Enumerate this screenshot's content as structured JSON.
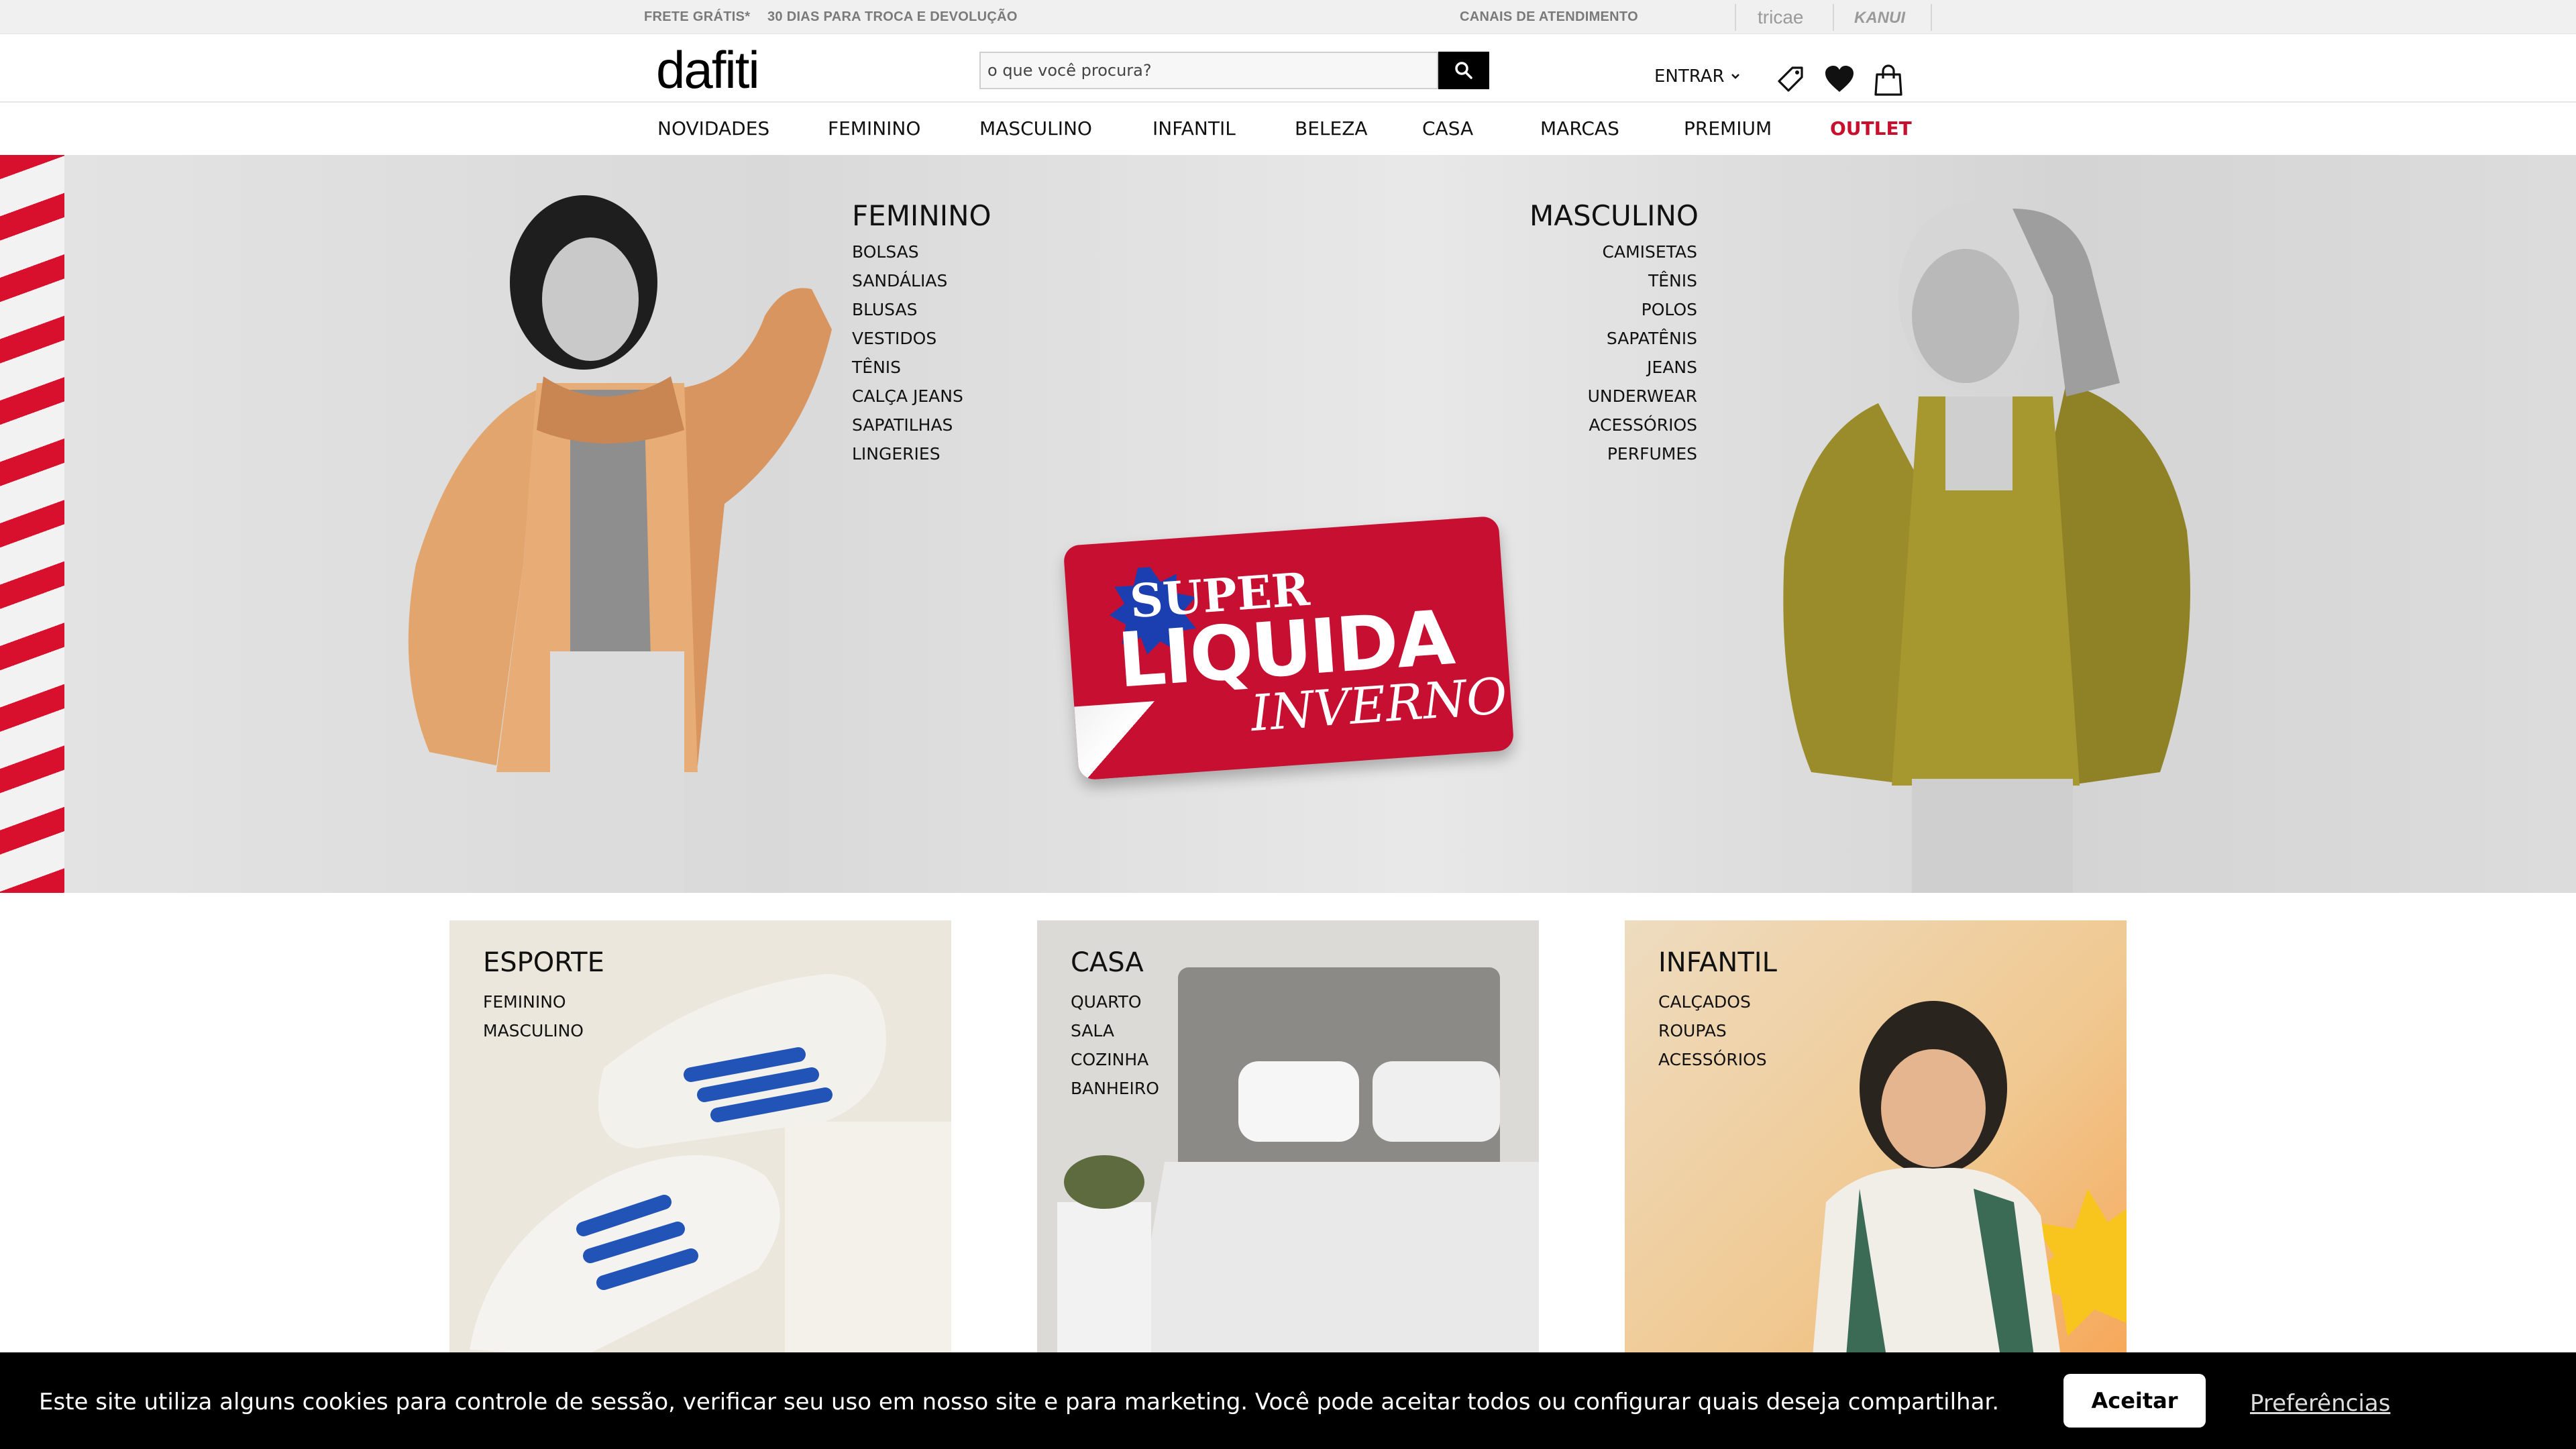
{
  "topbar": {
    "free_shipping": "FRETE GRÁTIS*",
    "returns": "30 DIAS PARA TROCA E DEVOLUÇÃO",
    "support": "CANAIS DE ATENDIMENTO",
    "brand_tricae": "tricae",
    "brand_kanui": "KANUI"
  },
  "header": {
    "logo": "dafiti",
    "search_placeholder": "o que você procura?",
    "login_label": "ENTRAR",
    "icons": [
      "search-icon",
      "chevron-down-icon",
      "tag-icon",
      "heart-icon",
      "bag-icon"
    ]
  },
  "nav": {
    "items": [
      "NOVIDADES",
      "FEMININO",
      "MASCULINO",
      "INFANTIL",
      "BELEZA",
      "CASA",
      "MARCAS",
      "PREMIUM",
      "OUTLET"
    ],
    "highlight_color": "#c8102e"
  },
  "hero": {
    "feminino": {
      "title": "FEMININO",
      "links": [
        "BOLSAS",
        "SANDÁLIAS",
        "BLUSAS",
        "VESTIDOS",
        "TÊNIS",
        "CALÇA JEANS",
        "SAPATILHAS",
        "LINGERIES"
      ]
    },
    "masculino": {
      "title": "MASCULINO",
      "links": [
        "CAMISETAS",
        "TÊNIS",
        "POLOS",
        "SAPATÊNIS",
        "JEANS",
        "UNDERWEAR",
        "ACESSÓRIOS",
        "PERFUMES"
      ]
    },
    "sticker": {
      "line1": "SUPER",
      "line2": "LIQUIDA",
      "line3": "INVERNO",
      "color": "#c70f32"
    }
  },
  "categories": [
    {
      "title": "ESPORTE",
      "links": [
        "FEMININO",
        "MASCULINO"
      ]
    },
    {
      "title": "CASA",
      "links": [
        "QUARTO",
        "SALA",
        "COZINHA",
        "BANHEIRO"
      ]
    },
    {
      "title": "INFANTIL",
      "links": [
        "CALÇADOS",
        "ROUPAS",
        "ACESSÓRIOS"
      ]
    }
  ],
  "cookie": {
    "text": "Este site utiliza alguns cookies para controle de sessão, verificar seu uso em nosso site e para marketing. Você pode aceitar todos ou configurar quais deseja compartilhar.",
    "accept": "Aceitar",
    "preferences": "Preferências"
  }
}
